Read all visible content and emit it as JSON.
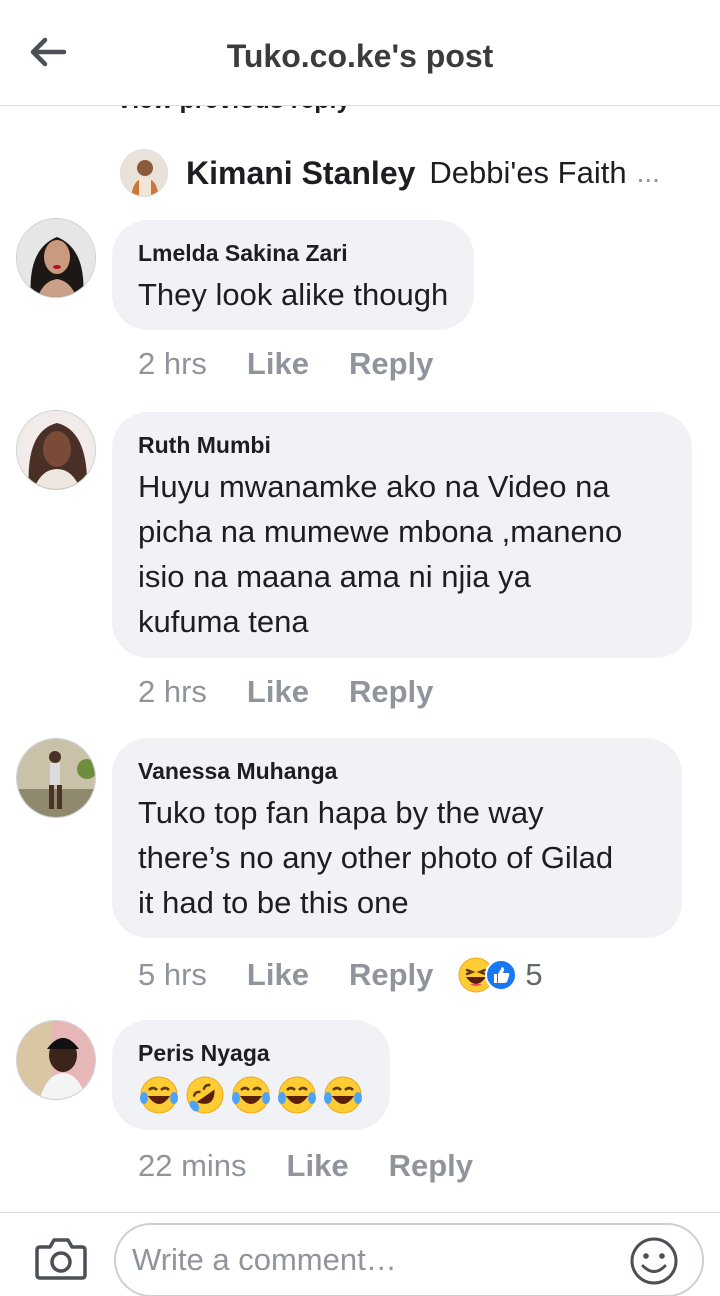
{
  "header": {
    "title": "Tuko.co.ke's post"
  },
  "thread": {
    "view_previous": "View previous reply",
    "reply_preview": {
      "name": "Kimani Stanley",
      "text": "Debbi'es Faith",
      "ellipsis": "..."
    }
  },
  "comments": [
    {
      "author": "Lmelda Sakina Zari",
      "lines": [
        "They look alike though"
      ],
      "time": "2 hrs",
      "like_label": "Like",
      "reply_label": "Reply"
    },
    {
      "author": "Ruth Mumbi",
      "lines": [
        "Huyu mwanamke ako na Video na",
        "picha na mumewe mbona ,maneno",
        "isio na maana ama ni njia ya",
        "kufuma tena"
      ],
      "time": "2 hrs",
      "like_label": "Like",
      "reply_label": "Reply"
    },
    {
      "author": "Vanessa Muhanga",
      "lines": [
        "Tuko top fan hapa by the way",
        "there’s no any other photo of Gilad",
        "it had to be this one"
      ],
      "time": "5 hrs",
      "like_label": "Like",
      "reply_label": "Reply",
      "reactions": {
        "icons": [
          "laugh-reaction-icon",
          "like-reaction-icon"
        ],
        "count": "5"
      }
    },
    {
      "author": "Peris Nyaga",
      "emojis": [
        "tears-of-joy-emoji",
        "rolling-laughing-emoji",
        "tears-of-joy-emoji",
        "tears-of-joy-emoji",
        "tears-of-joy-emoji"
      ],
      "time": "22 mins",
      "like_label": "Like",
      "reply_label": "Reply"
    }
  ],
  "composer": {
    "placeholder": "Write a comment…"
  },
  "colors": {
    "bubble": "#f0f2f5",
    "meta_text": "#90949c",
    "like_blue": "#1877f2",
    "emoji_yellow": "#ffcc33"
  }
}
